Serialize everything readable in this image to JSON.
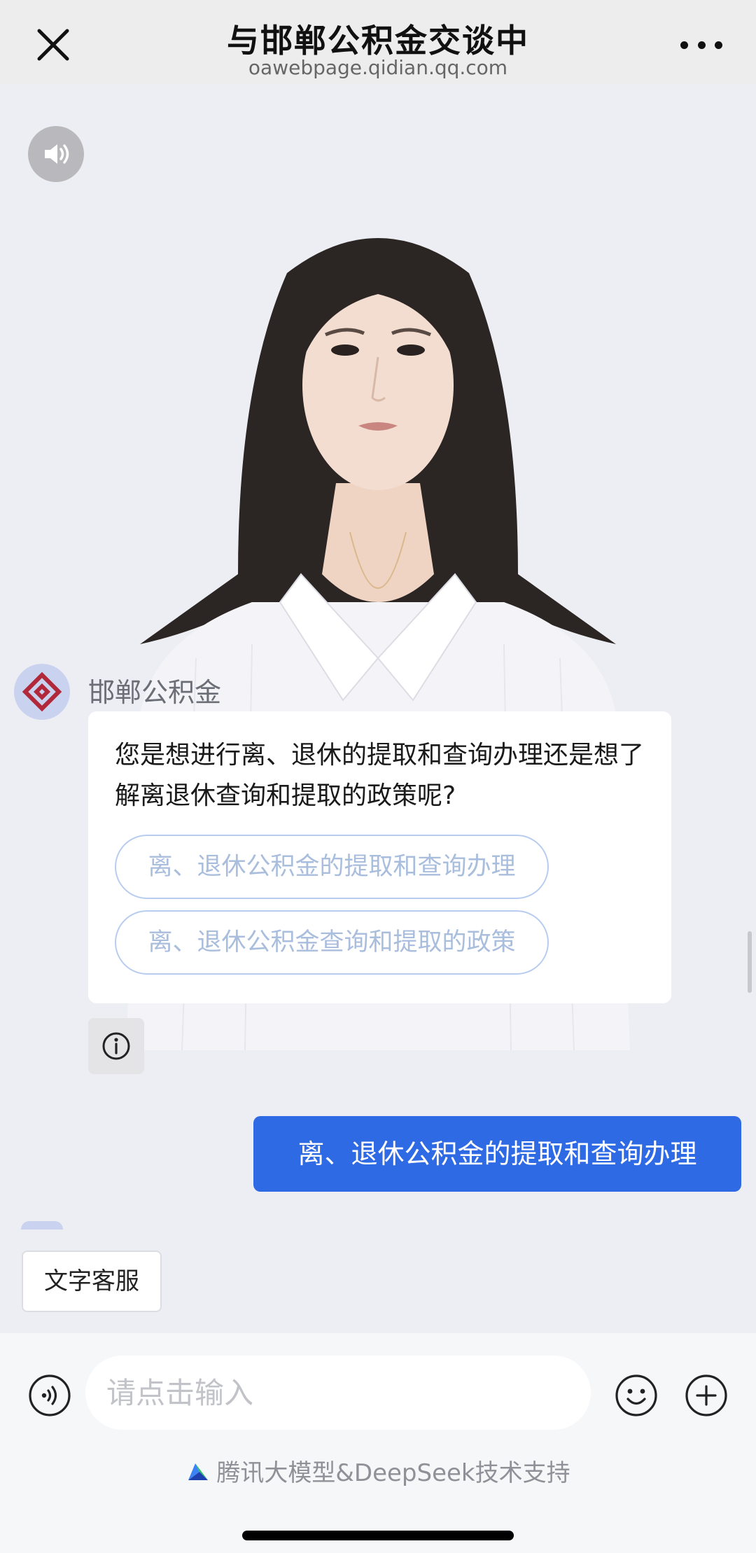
{
  "header": {
    "title": "与邯郸公积金交谈中",
    "url": "oawebpage.qidian.qq.com"
  },
  "bot": {
    "name": "邯郸公积金",
    "message": "您是想进行离、退休的提取和查询办理还是想了解离退休查询和提取的政策呢?",
    "options": [
      "离、退休公积金的提取和查询办理",
      "离、退休公积金查询和提取的政策"
    ]
  },
  "user": {
    "message": "离、退休公积金的提取和查询办理"
  },
  "text_service_label": "文字客服",
  "input": {
    "placeholder": "请点击输入",
    "value": ""
  },
  "footer": {
    "credit": "腾讯大模型&DeepSeek技术支持"
  },
  "icons": {
    "close": "close-icon",
    "more": "more-icon",
    "speaker": "speaker-icon",
    "info": "info-icon",
    "voice": "voice-icon",
    "emoji": "emoji-icon",
    "plus": "plus-icon",
    "logo": "hunyuan-logo-icon"
  },
  "colors": {
    "accent": "#2f6ae5",
    "background": "#edeef3",
    "option_border": "#b8ccf0",
    "option_text": "#a9bddd",
    "bot_logo": "#b0283a"
  }
}
